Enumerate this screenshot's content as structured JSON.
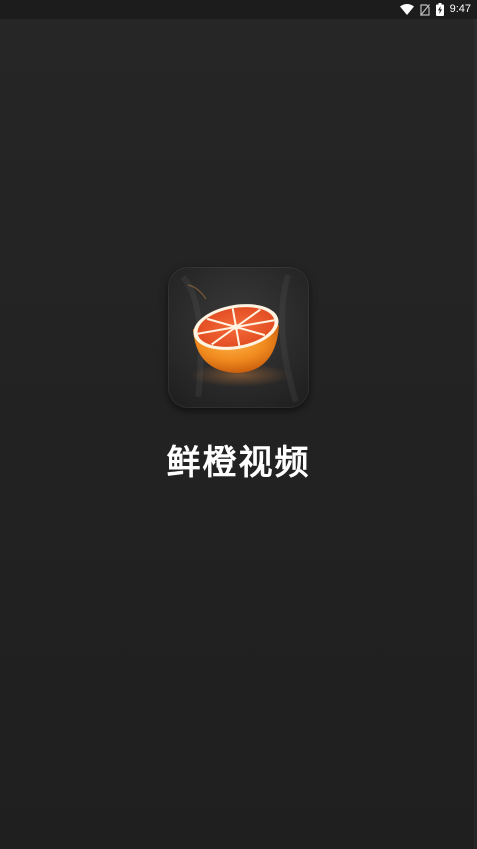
{
  "status_bar": {
    "time": "9:47",
    "icons": [
      "wifi-icon",
      "no-sim-icon",
      "battery-charging-icon"
    ]
  },
  "splash": {
    "logo_icon": "orange-half-icon",
    "app_name": "鲜橙视频"
  },
  "colors": {
    "background": "#232323",
    "orange_peel": "#f07a1f",
    "orange_flesh": "#ea5a27",
    "text": "#ffffff"
  }
}
